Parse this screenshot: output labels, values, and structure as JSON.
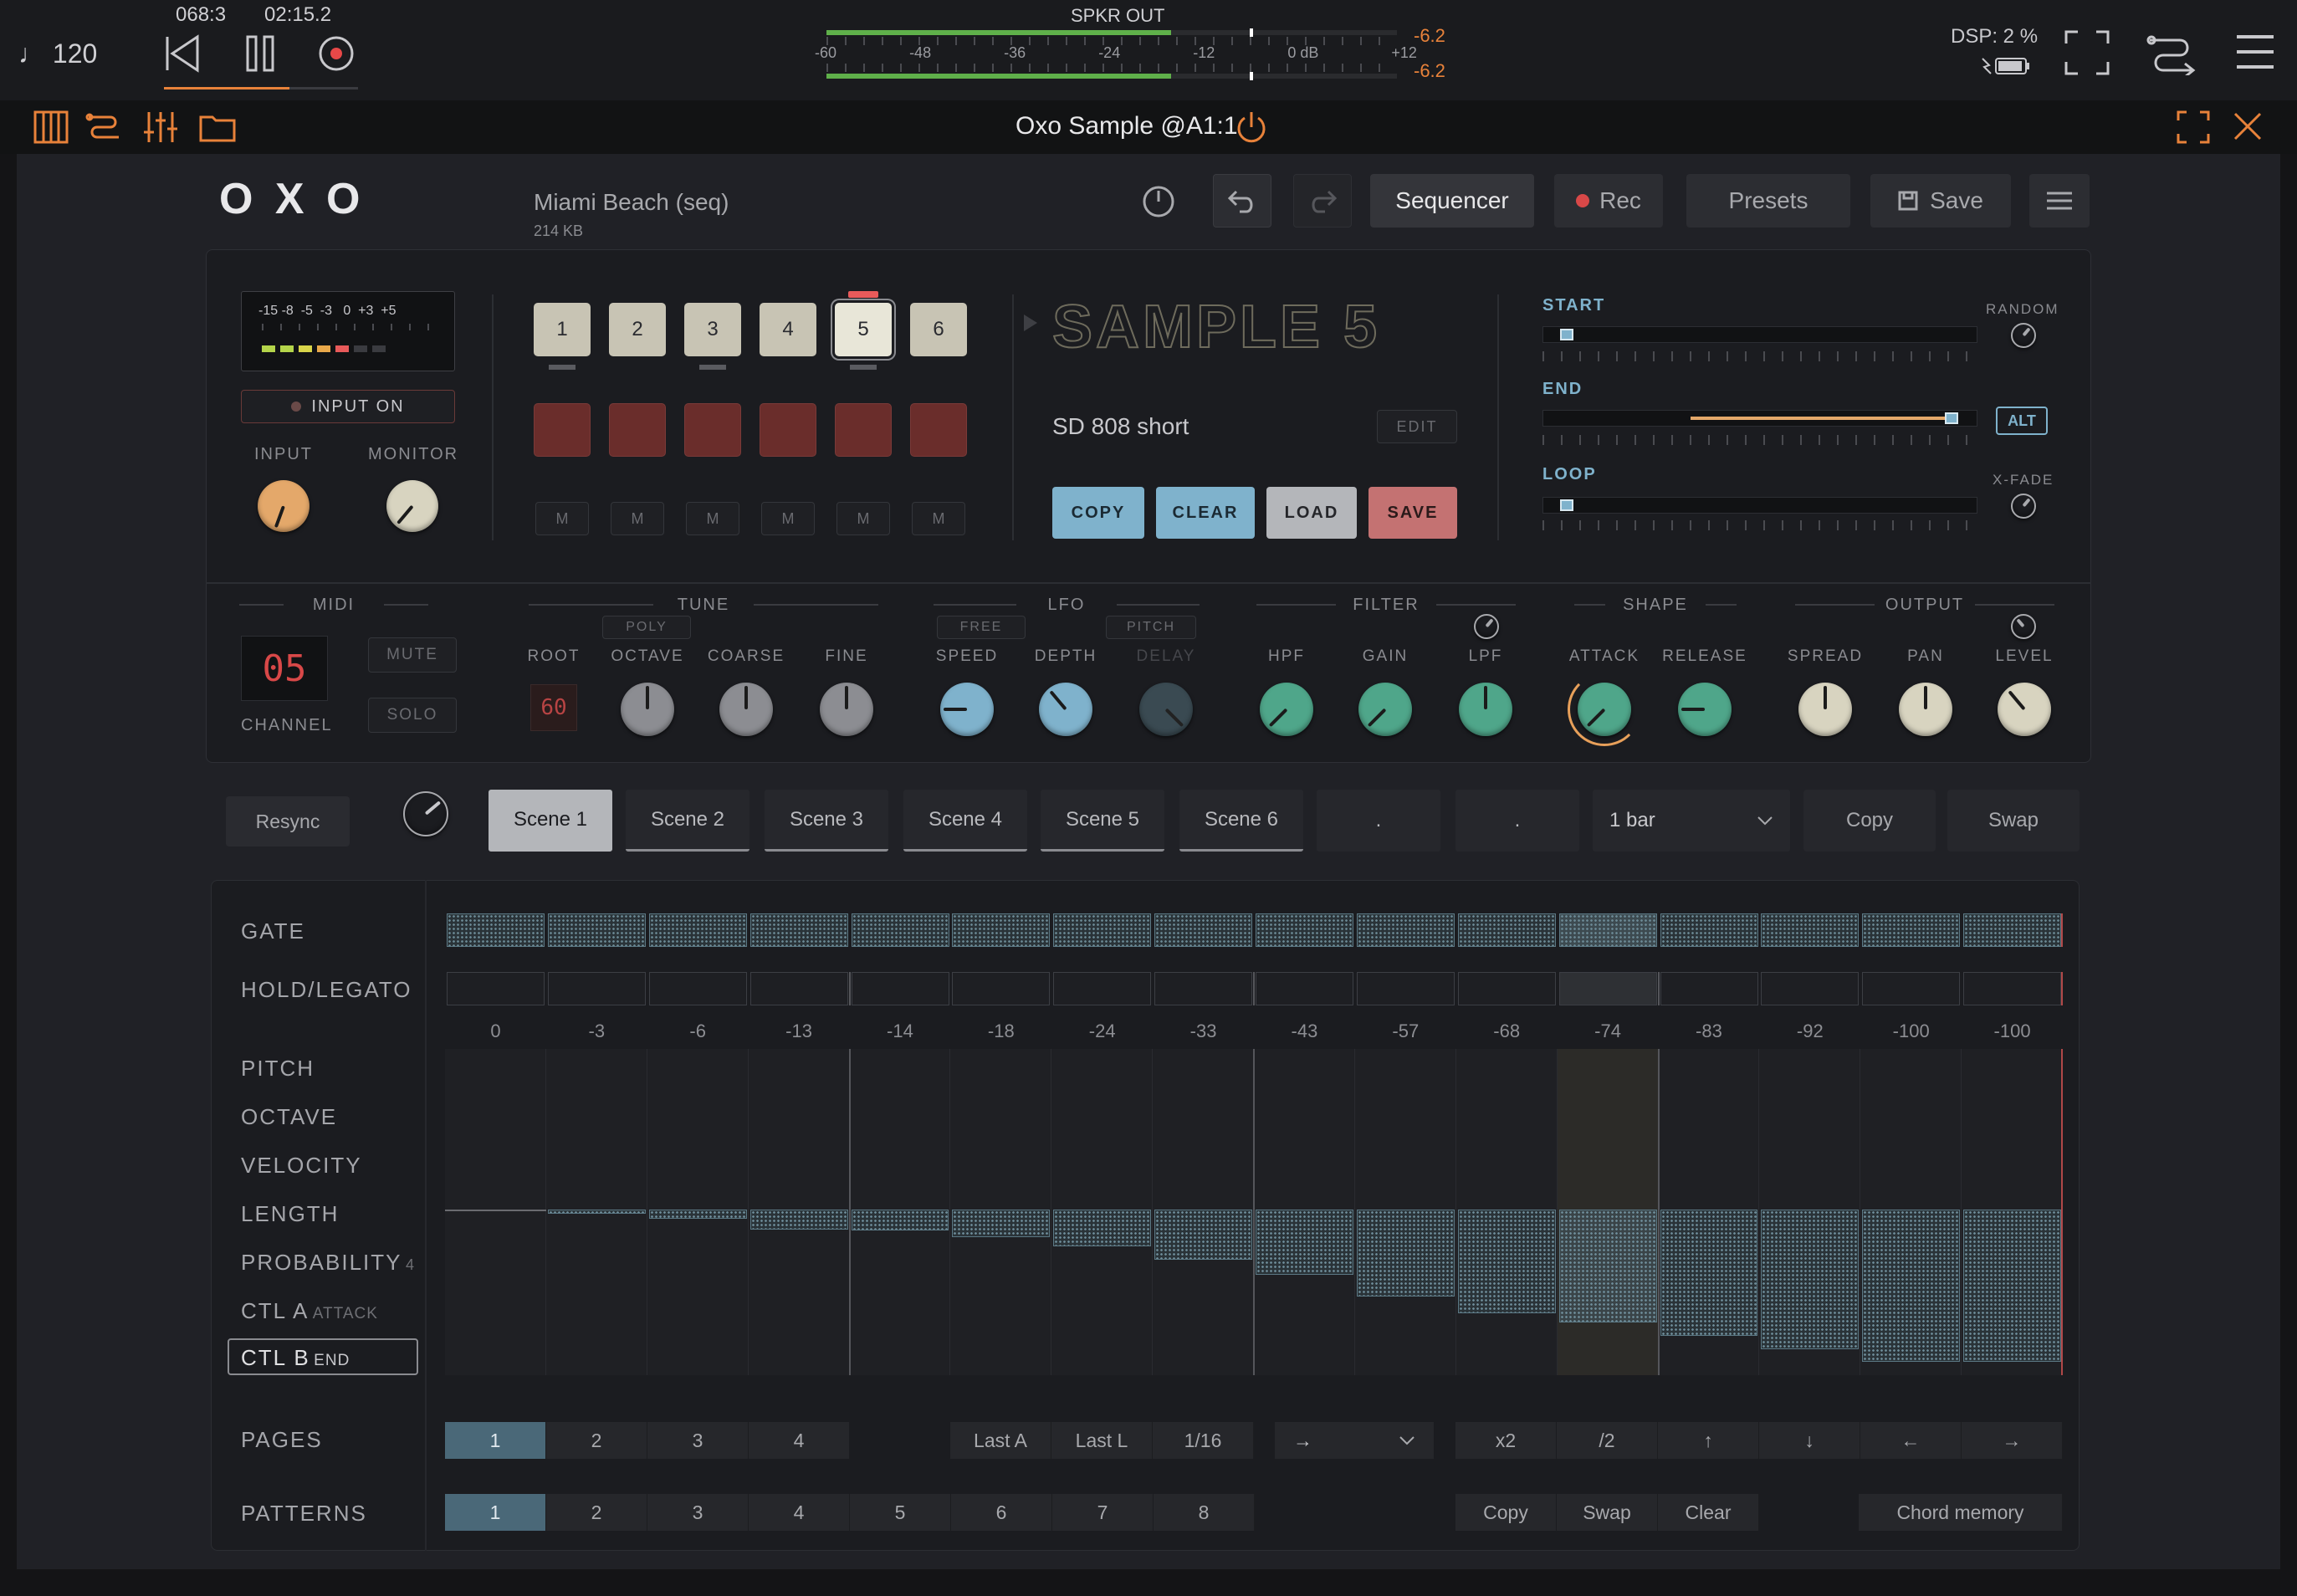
{
  "host": {
    "tempo": "♩ 120",
    "position": "068:3",
    "time": "02:15.2",
    "meter_title": "SPKR OUT",
    "meter_scale": [
      "-60",
      "-48",
      "-36",
      "-24",
      "-12",
      "0 dB",
      "+12"
    ],
    "peak_left": "-6.2",
    "peak_right": "-6.2",
    "dsp": "DSP:  2 %"
  },
  "plugin_header": {
    "title": "Oxo Sample @A1:1"
  },
  "top": {
    "logo": "O X O",
    "preset_name": "Miami Beach (seq)",
    "preset_size": "214 KB",
    "sequencer_label": "Sequencer",
    "rec_label": "Rec",
    "presets_label": "Presets",
    "save_label": "Save"
  },
  "input": {
    "meter_scale": "-15 -8  -5  -3   0  +3  +5",
    "input_on": "INPUT ON",
    "input_label": "INPUT",
    "monitor_label": "MONITOR"
  },
  "pads": {
    "numbers": [
      "1",
      "2",
      "3",
      "4",
      "5",
      "6"
    ],
    "mute": [
      "M",
      "M",
      "M",
      "M",
      "M",
      "M"
    ],
    "selected": 5
  },
  "sample": {
    "title": "SAMPLE 5",
    "name": "SD 808 short",
    "edit": "EDIT",
    "copy": "COPY",
    "clear": "CLEAR",
    "load": "LOAD",
    "save": "SAVE"
  },
  "region": {
    "start": "START",
    "end": "END",
    "loop": "LOOP",
    "random": "RANDOM",
    "alt": "ALT",
    "xfade": "X-FADE",
    "start_pos": 0.04,
    "end_pos": 0.96,
    "loop_pos": 0.04
  },
  "controls": {
    "midi": "MIDI",
    "channel_value": "05",
    "channel": "CHANNEL",
    "mute": "MUTE",
    "solo": "SOLO",
    "tune": "TUNE",
    "poly": "POLY",
    "root": "ROOT",
    "root_value": "60",
    "octave": "OCTAVE",
    "coarse": "COARSE",
    "fine": "FINE",
    "lfo": "LFO",
    "free": "FREE",
    "pitch": "PITCH",
    "speed": "SPEED",
    "depth": "DEPTH",
    "delay": "DELAY",
    "filter": "FILTER",
    "hpf": "HPF",
    "gain": "GAIN",
    "lpf": "LPF",
    "shape": "SHAPE",
    "attack": "ATTACK",
    "release": "RELEASE",
    "output": "OUTPUT",
    "spread": "SPREAD",
    "pan": "PAN",
    "level": "LEVEL"
  },
  "scenes": {
    "resync": "Resync",
    "items": [
      "Scene 1",
      "Scene 2",
      "Scene 3",
      "Scene 4",
      "Scene 5",
      "Scene 6",
      ".",
      "."
    ],
    "length": "1 bar",
    "copy": "Copy",
    "swap": "Swap"
  },
  "seq": {
    "labels": {
      "gate": "GATE",
      "hold": "HOLD/LEGATO",
      "pitch": "PITCH",
      "octave": "OCTAVE",
      "velocity": "VELOCITY",
      "length": "LENGTH",
      "probability": "PROBABILITY",
      "probability_val": "4",
      "ctla": "CTL A",
      "ctla_sub": "ATTACK",
      "ctlb": "CTL B",
      "ctlb_sub": "END",
      "pages": "PAGES",
      "patterns": "PATTERNS"
    },
    "values": [
      0,
      -3,
      -6,
      -13,
      -14,
      -18,
      -24,
      -33,
      -43,
      -57,
      -68,
      -74,
      -83,
      -92,
      -100,
      -100
    ],
    "value_labels": [
      "0",
      "-3",
      "-6",
      "-13",
      "-14",
      "-18",
      "-24",
      "-33",
      "-43",
      "-57",
      "-68",
      "-74",
      "-83",
      "-92",
      "-100",
      "-100"
    ],
    "playhead": 11,
    "pages": [
      "1",
      "2",
      "3",
      "4"
    ],
    "page_tools": [
      "Last A",
      "Last L",
      "1/16"
    ],
    "direction": "→",
    "page_ops": [
      "x2",
      "/2",
      "↑",
      "↓",
      "←",
      "→"
    ],
    "patterns": [
      "1",
      "2",
      "3",
      "4",
      "5",
      "6",
      "7",
      "8"
    ],
    "pattern_ops": [
      "Copy",
      "Swap",
      "Clear"
    ],
    "chord_memory": "Chord memory"
  },
  "colors": {
    "accent": "#e8823a",
    "teal": "#4fa68a",
    "blue": "#7fb2cc",
    "pad_red": "#6a2d2b"
  }
}
